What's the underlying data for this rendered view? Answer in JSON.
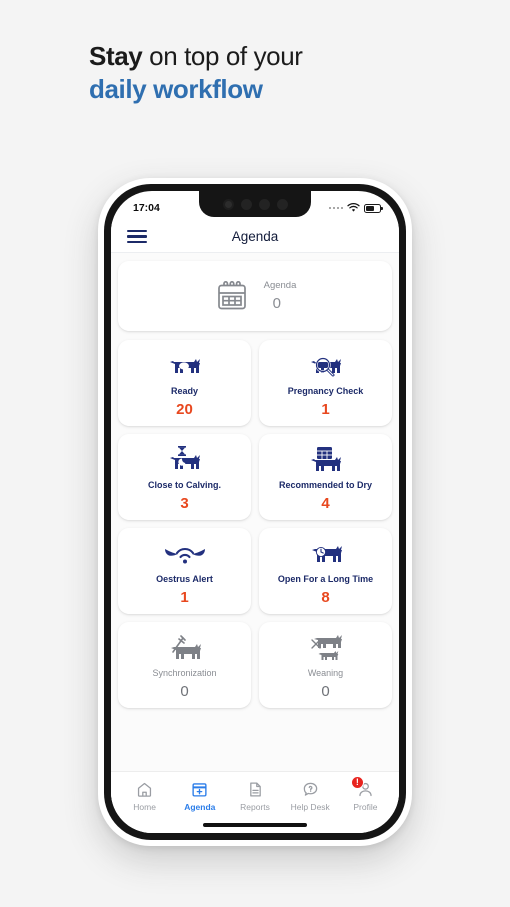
{
  "headline": {
    "line1_bold": "Stay",
    "line1_rest": " on top of your",
    "line2": "daily workflow"
  },
  "colors": {
    "navy": "#1c2a68",
    "orange": "#e8481f",
    "accent_blue": "#2b7de9",
    "headline_blue": "#2f6fb0",
    "muted": "#8a8d93",
    "badge_red": "#e8241f"
  },
  "phone": {
    "status_bar": {
      "time": "17:04",
      "signal_icon": "signal-dots-icon",
      "wifi_icon": "wifi-icon",
      "battery_icon": "battery-icon"
    },
    "app_bar": {
      "menu_icon": "hamburger-menu-icon",
      "title": "Agenda"
    },
    "agenda_card": {
      "icon": "calendar-icon",
      "label": "Agenda",
      "value": "0"
    },
    "tiles": [
      {
        "icon": "cow-ready-icon",
        "label": "Ready",
        "value": "20",
        "state": "active"
      },
      {
        "icon": "cow-magnifier-icon",
        "label": "Pregnancy Check",
        "value": "1",
        "state": "active"
      },
      {
        "icon": "cow-hourglass-icon",
        "label": "Close to Calving.",
        "value": "3",
        "state": "active"
      },
      {
        "icon": "cow-calendar-icon",
        "label": "Recommended to Dry",
        "value": "4",
        "state": "active"
      },
      {
        "icon": "horns-signal-icon",
        "label": "Oestrus Alert",
        "value": "1",
        "state": "active"
      },
      {
        "icon": "cow-clock-icon",
        "label": "Open For a Long Time",
        "value": "8",
        "state": "active"
      },
      {
        "icon": "cow-syringe-icon",
        "label": "Synchronization",
        "value": "0",
        "state": "muted"
      },
      {
        "icon": "cow-calf-icon",
        "label": "Weaning",
        "value": "0",
        "state": "muted"
      }
    ],
    "bottom_nav": [
      {
        "icon": "home-icon",
        "label": "Home",
        "active": false,
        "badge": ""
      },
      {
        "icon": "calendar-plus-icon",
        "label": "Agenda",
        "active": true,
        "badge": ""
      },
      {
        "icon": "document-icon",
        "label": "Reports",
        "active": false,
        "badge": ""
      },
      {
        "icon": "chat-question-icon",
        "label": "Help Desk",
        "active": false,
        "badge": ""
      },
      {
        "icon": "person-icon",
        "label": "Profile",
        "active": false,
        "badge": "!"
      }
    ]
  }
}
